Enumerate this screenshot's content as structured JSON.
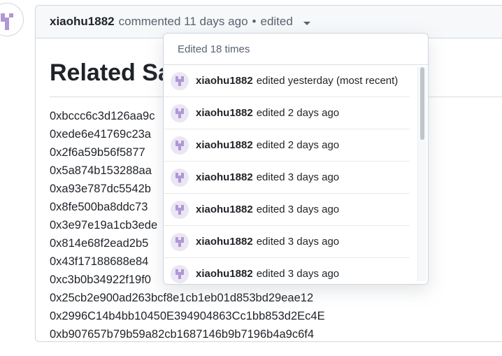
{
  "comment": {
    "author": "xiaohu1882",
    "action": "commented 11 days ago",
    "separator": "•",
    "edited_label": "edited",
    "heading": "Related Sa",
    "addresses": [
      "0xbccc6c3d126aa9c",
      "0xede6e41769c23a",
      "0x2f6a59b56f5877",
      "0x5a874b153288aa",
      "0xa93e787dc5542b",
      "0x8fe500ba8ddc73",
      "0x3e97e19a1cb3ede",
      "0x814e68f2ead2b5",
      "0x43f17188688e84",
      "0xc3b0b34922f19f0",
      "0x25cb2e900ad263bcf8e1cb1eb01d853bd29eae12",
      "0x2996C14b4bb10450E394904863Cc1bb853d2Ec4E",
      "0xb907657b79b59a82cb1687146b9b7196b4a9c6f4"
    ]
  },
  "dropdown": {
    "header": "Edited 18 times",
    "items": [
      {
        "name": "xiaohu1882",
        "text": "edited yesterday (most recent)"
      },
      {
        "name": "xiaohu1882",
        "text": "edited 2 days ago"
      },
      {
        "name": "xiaohu1882",
        "text": "edited 2 days ago"
      },
      {
        "name": "xiaohu1882",
        "text": "edited 3 days ago"
      },
      {
        "name": "xiaohu1882",
        "text": "edited 3 days ago"
      },
      {
        "name": "xiaohu1882",
        "text": "edited 3 days ago"
      },
      {
        "name": "xiaohu1882",
        "text": "edited 3 days ago"
      }
    ]
  },
  "icons": {
    "avatar": "identicon-avatar-icon",
    "caret": "caret-down-icon"
  },
  "colors": {
    "avatar_purple": "#b197d6",
    "text_muted": "#59636e"
  }
}
